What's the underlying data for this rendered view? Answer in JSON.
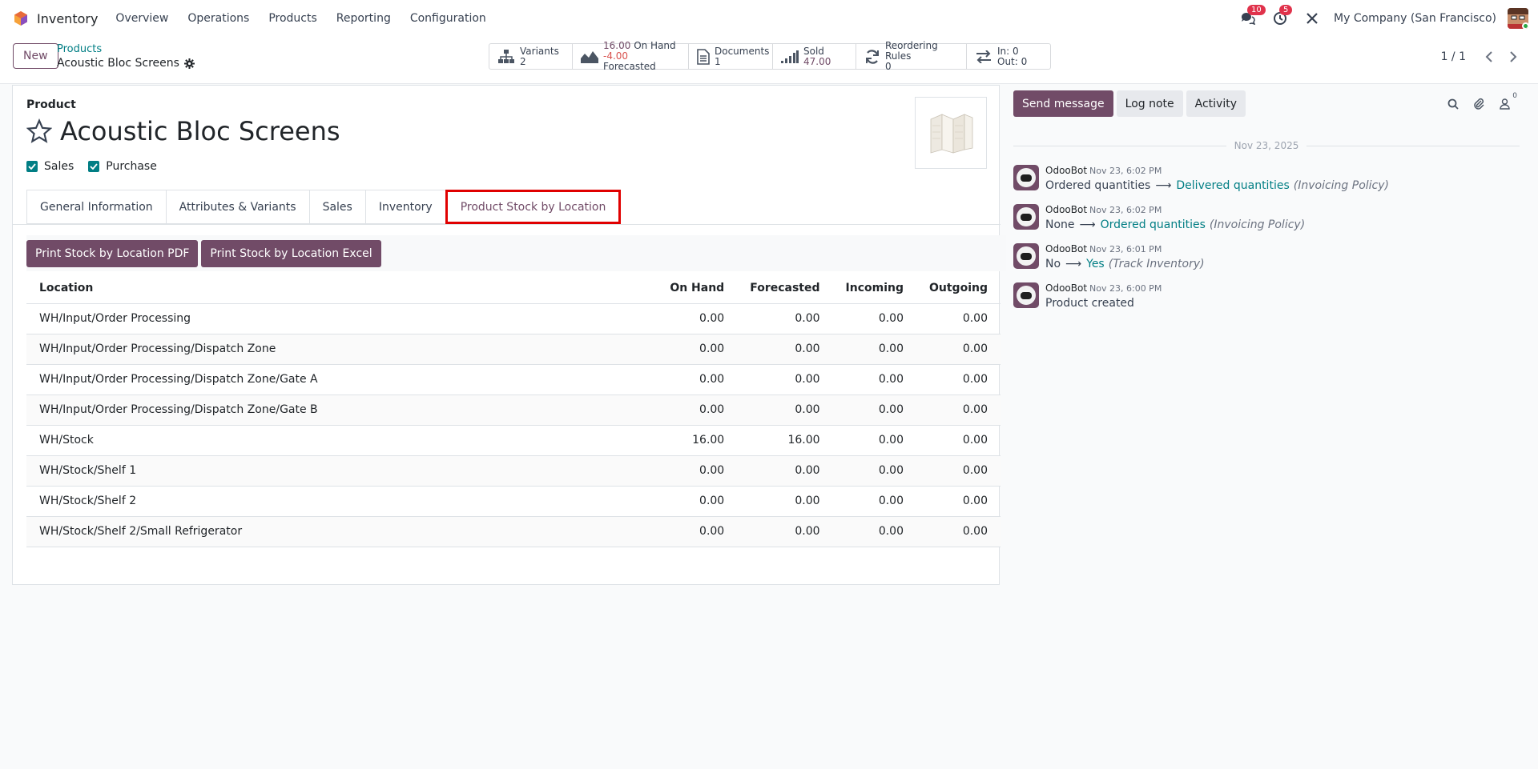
{
  "navbar": {
    "app_name": "Inventory",
    "menu": [
      "Overview",
      "Operations",
      "Products",
      "Reporting",
      "Configuration"
    ],
    "messages_badge": "10",
    "activities_badge": "5",
    "company": "My Company (San Francisco)"
  },
  "control": {
    "new_label": "New",
    "breadcrumb_parent": "Products",
    "breadcrumb_current": "Acoustic Bloc Screens",
    "pager": "1 / 1",
    "smart_buttons": {
      "variants_label": "Variants",
      "variants_value": "2",
      "onhand_value": "16.00",
      "onhand_label": "On Hand",
      "forecast_value": "-4.00",
      "forecast_label": "Forecasted",
      "documents_label": "Documents",
      "documents_value": "1",
      "sold_label": "Sold",
      "sold_value": "47.00",
      "reorder_label": "Reordering Rules",
      "reorder_value": "0",
      "in_label": "In: 0",
      "out_label": "Out: 0"
    }
  },
  "form": {
    "product_label": "Product",
    "title": "Acoustic Bloc Screens",
    "sales_check": "Sales",
    "purchase_check": "Purchase",
    "tabs": [
      "General Information",
      "Attributes & Variants",
      "Sales",
      "Inventory",
      "Product Stock by Location"
    ],
    "print_pdf": "Print Stock by Location PDF",
    "print_excel": "Print Stock by Location Excel",
    "table": {
      "headers": [
        "Location",
        "On Hand",
        "Forecasted",
        "Incoming",
        "Outgoing"
      ],
      "rows": [
        [
          "WH/Input/Order Processing",
          "0.00",
          "0.00",
          "0.00",
          "0.00"
        ],
        [
          "WH/Input/Order Processing/Dispatch Zone",
          "0.00",
          "0.00",
          "0.00",
          "0.00"
        ],
        [
          "WH/Input/Order Processing/Dispatch Zone/Gate A",
          "0.00",
          "0.00",
          "0.00",
          "0.00"
        ],
        [
          "WH/Input/Order Processing/Dispatch Zone/Gate B",
          "0.00",
          "0.00",
          "0.00",
          "0.00"
        ],
        [
          "WH/Stock",
          "16.00",
          "16.00",
          "0.00",
          "0.00"
        ],
        [
          "WH/Stock/Shelf 1",
          "0.00",
          "0.00",
          "0.00",
          "0.00"
        ],
        [
          "WH/Stock/Shelf 2",
          "0.00",
          "0.00",
          "0.00",
          "0.00"
        ],
        [
          "WH/Stock/Shelf 2/Small Refrigerator",
          "0.00",
          "0.00",
          "0.00",
          "0.00"
        ]
      ]
    }
  },
  "chatter": {
    "send_message": "Send message",
    "log_note": "Log note",
    "activity": "Activity",
    "followers_count": "0",
    "date_separator": "Nov 23, 2025",
    "messages": [
      {
        "author": "OdooBot",
        "date": "Nov 23, 6:02 PM",
        "old": "Ordered quantities",
        "new": "Delivered quantities",
        "field": "(Invoicing Policy)"
      },
      {
        "author": "OdooBot",
        "date": "Nov 23, 6:02 PM",
        "old": "None",
        "new": "Ordered quantities",
        "field": "(Invoicing Policy)"
      },
      {
        "author": "OdooBot",
        "date": "Nov 23, 6:01 PM",
        "old": "No",
        "new": "Yes",
        "field": "(Track Inventory)"
      },
      {
        "author": "OdooBot",
        "date": "Nov 23, 6:00 PM",
        "body": "Product created"
      }
    ]
  },
  "colors": {
    "brand": "#714B67",
    "link": "#017e84",
    "highlight": "#e00000",
    "negative": "#d9534f"
  }
}
